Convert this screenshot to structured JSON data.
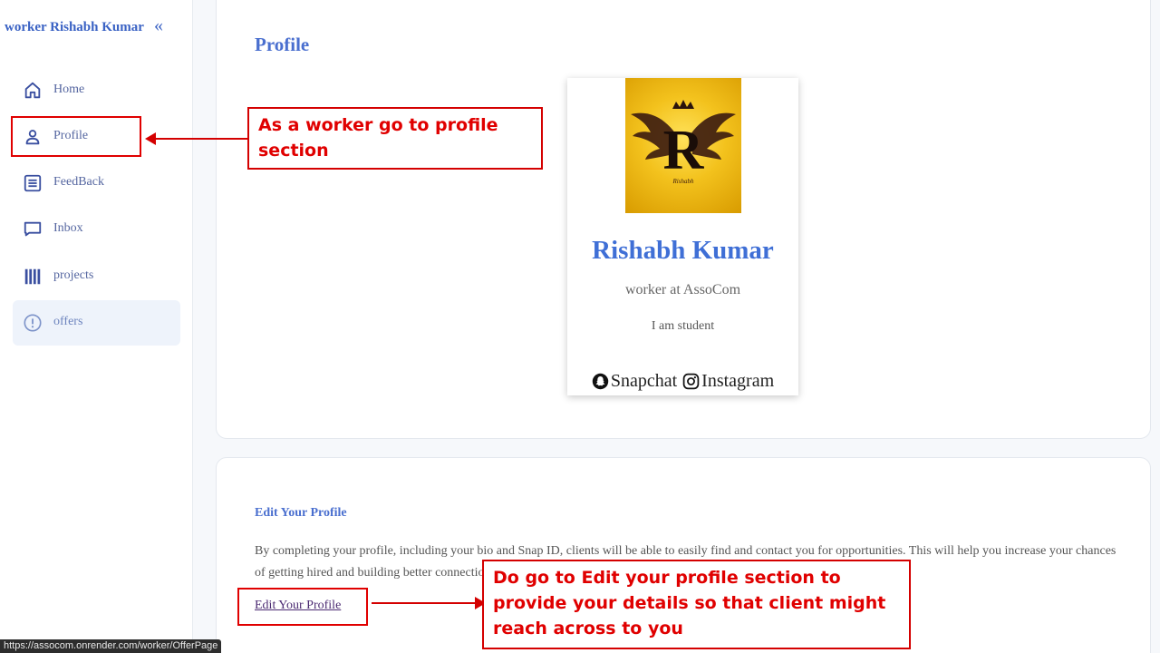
{
  "sidebar": {
    "title": "worker Rishabh Kumar",
    "collapse_symbol": "«",
    "items": [
      {
        "label": "Home",
        "icon": "home-icon"
      },
      {
        "label": "Profile",
        "icon": "user-icon"
      },
      {
        "label": "FeedBack",
        "icon": "list-icon"
      },
      {
        "label": "Inbox",
        "icon": "inbox-icon"
      },
      {
        "label": "projects",
        "icon": "projects-icon"
      },
      {
        "label": "offers",
        "icon": "alert-circle-icon",
        "active": true
      }
    ]
  },
  "main": {
    "page_title": "Profile",
    "profile_card": {
      "name": "Rishabh Kumar",
      "role": "worker at AssoCom",
      "bio": "I am student",
      "social": [
        {
          "label": "Snapchat",
          "icon": "snapchat-icon"
        },
        {
          "label": "Instagram",
          "icon": "instagram-icon"
        }
      ]
    },
    "edit_section": {
      "heading": "Edit Your Profile",
      "description": "By completing your profile, including your bio and Snap ID, clients will be able to easily find and contact you for opportunities. This will help you increase your chances of getting hired and building better connections.",
      "link_label": "Edit Your Profile"
    }
  },
  "annotations": {
    "note_profile": "As a worker go to profile section",
    "note_edit": "Do go to Edit your profile section to provide your details so that client might reach across to you"
  },
  "status_bar": {
    "url": "https://assocom.onrender.com/worker/OfferPage"
  },
  "colors": {
    "accent": "#4a6fcf",
    "annotation": "#e00000",
    "avatar_bg": "#f3c21d"
  }
}
